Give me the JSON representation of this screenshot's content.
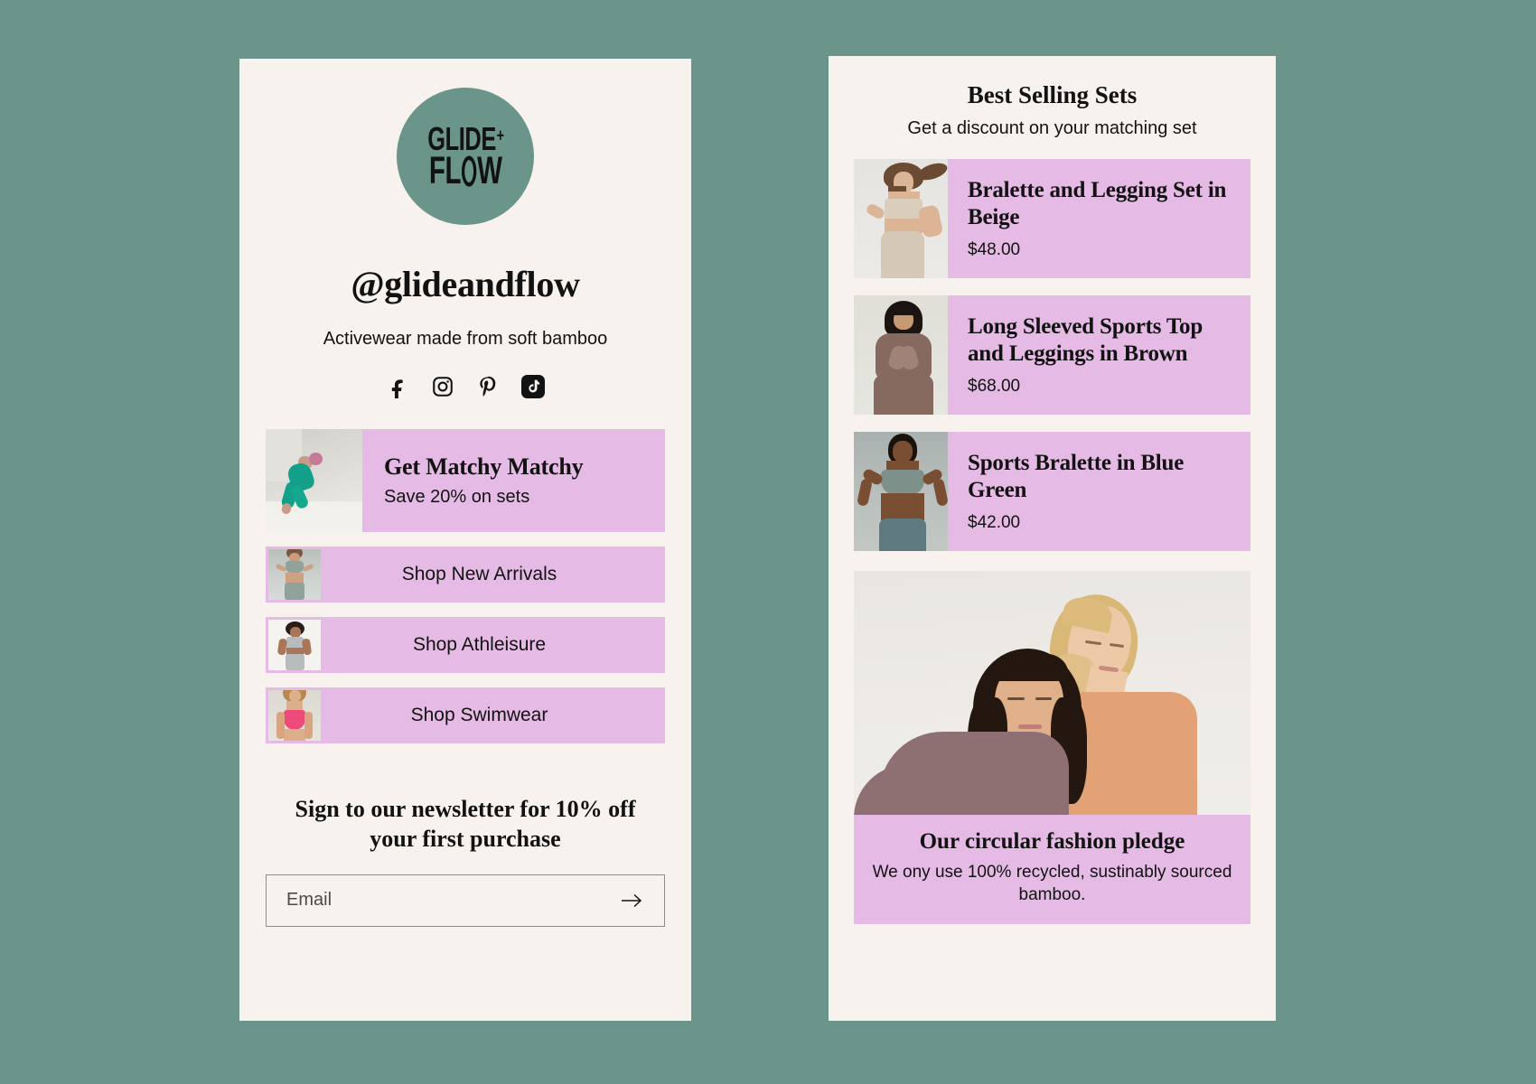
{
  "theme": {
    "background": "#6b958a",
    "panel": "#f7f2ee",
    "accent_lilac": "#e5bbe5",
    "ink": "#121212",
    "sage": "#6b958a"
  },
  "left_panel": {
    "logo": {
      "line1": "GLIDE",
      "plus": "+",
      "line2_before": "FL",
      "line2_after": "W",
      "circle_color": "#6b958a"
    },
    "handle": "@glideandflow",
    "tagline": "Activewear made from soft bamboo",
    "socials": [
      {
        "name": "facebook-icon",
        "label": "Facebook"
      },
      {
        "name": "instagram-icon",
        "label": "Instagram"
      },
      {
        "name": "pinterest-icon",
        "label": "Pinterest"
      },
      {
        "name": "tiktok-icon",
        "label": "TikTok"
      }
    ],
    "promo": {
      "title": "Get Matchy Matchy",
      "subtitle": "Save 20% on sets"
    },
    "links": [
      {
        "label": "Shop New Arrivals"
      },
      {
        "label": "Shop Athleisure"
      },
      {
        "label": "Shop Swimwear"
      }
    ],
    "newsletter": {
      "heading": "Sign to our newsletter for 10% off your first purchase",
      "placeholder": "Email",
      "value": "",
      "submit_icon": "arrow-right-icon"
    }
  },
  "right_panel": {
    "heading": "Best Selling Sets",
    "subheading": "Get a discount on your matching set",
    "products": [
      {
        "name": "Bralette and Legging Set in Beige",
        "price": "$48.00"
      },
      {
        "name": "Long Sleeved Sports Top and Leggings in Brown",
        "price": "$68.00"
      },
      {
        "name": "Sports Bralette in Blue Green",
        "price": "$42.00"
      }
    ],
    "pledge": {
      "title": "Our circular fashion pledge",
      "text": "We ony use 100% recycled, sustinably sourced bamboo."
    }
  }
}
